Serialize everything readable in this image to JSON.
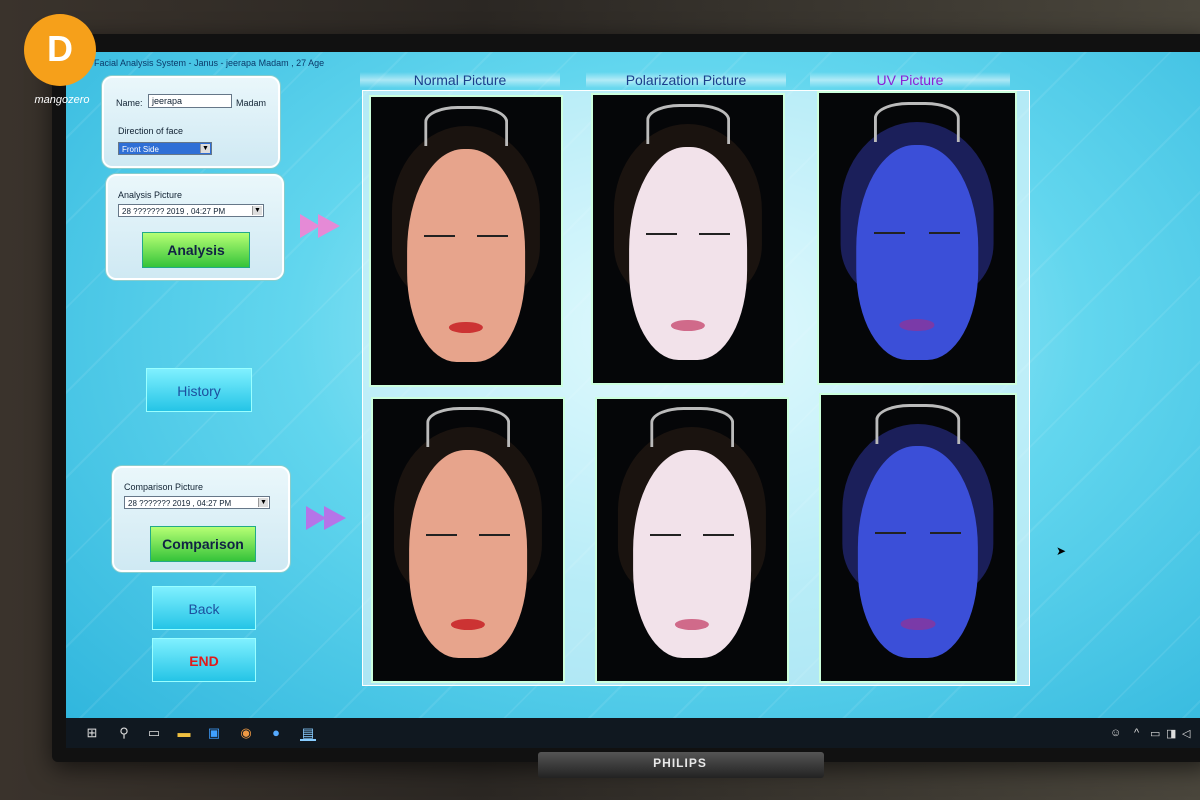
{
  "app": {
    "title": "Facial Analysis System - Janus - jeerapa Madam , 27 Age"
  },
  "identity": {
    "name_label": "Name:",
    "name_value": "jeerapa",
    "salutation": "Madam",
    "direction_label": "Direction of face",
    "direction_value": "Front Side"
  },
  "analysis": {
    "label": "Analysis Picture",
    "selected": "28 ??????? 2019 , 04:27 PM",
    "button": "Analysis"
  },
  "history_button": "History",
  "comparison": {
    "label": "Comparison Picture",
    "selected": "28 ??????? 2019 , 04:27 PM",
    "button": "Comparison"
  },
  "back_button": "Back",
  "end_button": "END",
  "columns": [
    {
      "title": "Normal Picture"
    },
    {
      "title": "Polarization Picture"
    },
    {
      "title": "UV Picture"
    }
  ],
  "colors": {
    "normal_skin": "#e7a48c",
    "polarized_skin": "#f2e2ea",
    "uv_skin": "#3b4fd8"
  },
  "taskbar": {
    "icons": [
      "windows-icon",
      "search-icon",
      "task-view-icon",
      "file-explorer-icon",
      "store-icon",
      "chrome-icon",
      "app-icon",
      "app-active-icon"
    ],
    "tray": [
      "person-icon",
      "chevron-up-icon",
      "battery-icon",
      "network-icon",
      "volume-icon"
    ]
  },
  "monitor_brand": "PHILIPS",
  "watermark": "mangozero"
}
